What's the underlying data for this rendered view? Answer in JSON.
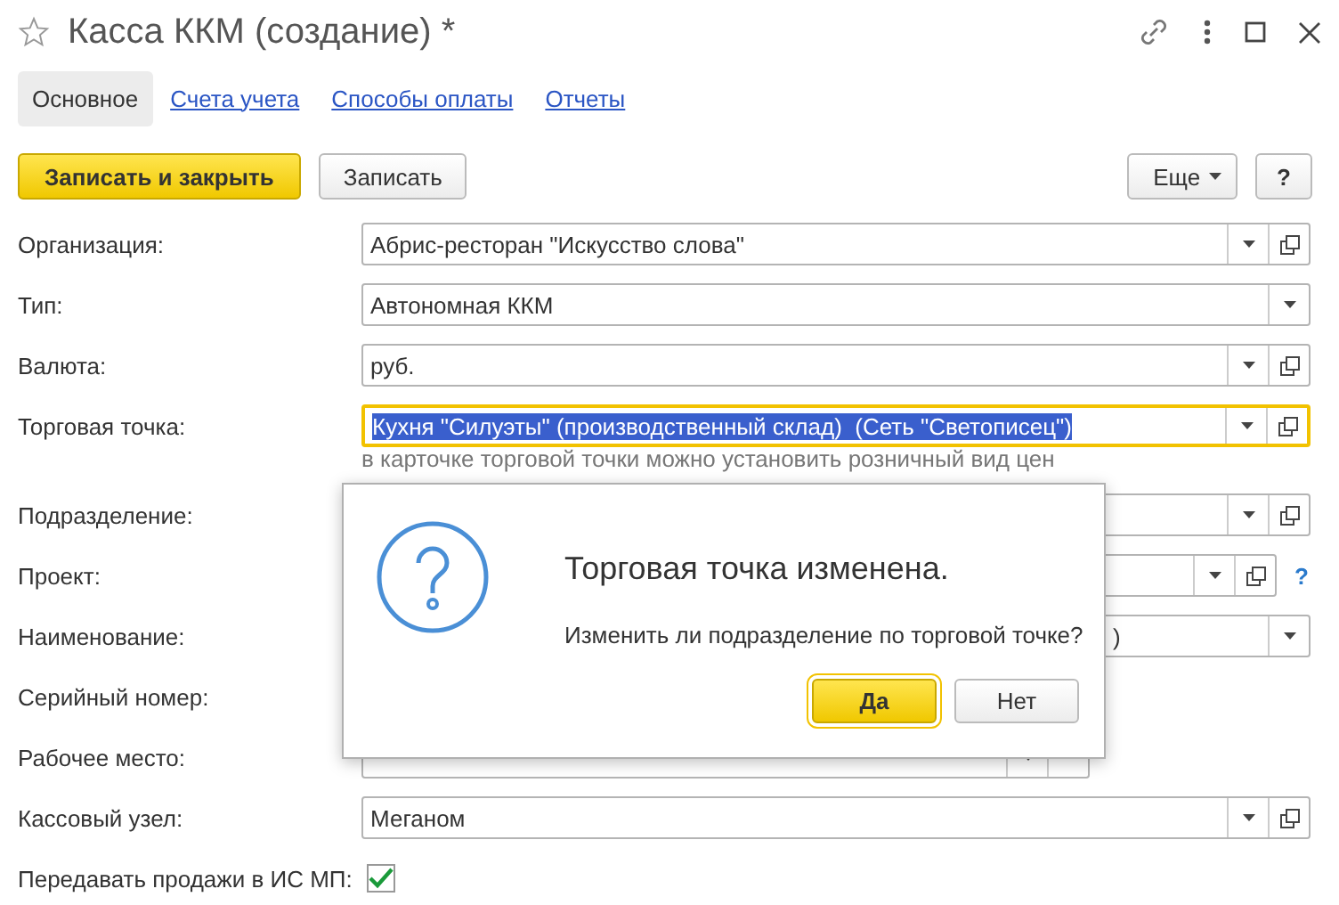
{
  "window": {
    "title": "Касса ККМ (создание) *",
    "favorite": false
  },
  "tabs": [
    {
      "label": "Основное",
      "selected": true
    },
    {
      "label": "Счета учета",
      "selected": false
    },
    {
      "label": "Способы оплаты",
      "selected": false
    },
    {
      "label": "Отчеты",
      "selected": false
    }
  ],
  "toolbar": {
    "buttons": [
      {
        "label": "Записать и закрыть",
        "kind": "primary"
      },
      {
        "label": "Записать",
        "kind": "plain"
      }
    ],
    "more": "Еще",
    "help": "?"
  },
  "fields": [
    {
      "label": "Организация:",
      "kind": "select-open",
      "value": "Абрис-ресторан \"Искусство слова\"",
      "focused": false
    },
    {
      "label": "Тип:",
      "kind": "select",
      "value": "Автономная ККМ",
      "focused": false
    },
    {
      "label": "Валюта:",
      "kind": "select-open",
      "value": "руб.",
      "focused": false
    },
    {
      "label": "Торговая точка:",
      "kind": "select-open",
      "value": "Кухня \"Силуэты\" (производственный склад)  (Сеть \"Светописец\")",
      "focused": true,
      "hint": "в карточке торговой точки можно установить розничный вид цен"
    },
    {
      "label": "Подразделение:",
      "kind": "select-open",
      "focused": false
    },
    {
      "label": "Проект:",
      "kind": "select-open-help",
      "help": "?",
      "focused": false
    },
    {
      "label": "Наименование:",
      "kind": "select-tail",
      "value": ")",
      "focused": false
    },
    {
      "label": "Серийный номер:",
      "kind": "none"
    },
    {
      "label": "Рабочее место:",
      "kind": "select-open-short",
      "focused": false
    },
    {
      "label": "Кассовый узел:",
      "kind": "select-open",
      "value": "Меганом",
      "focused": false
    },
    {
      "label": "Передавать продажи в ИС МП:",
      "kind": "checkbox",
      "checked": true
    }
  ],
  "dialog": {
    "title": "Торговая точка изменена.",
    "message": "Изменить ли подразделение по торговой точке?",
    "buttons": [
      {
        "label": "Да",
        "default": true
      },
      {
        "label": "Нет",
        "default": false
      }
    ]
  }
}
